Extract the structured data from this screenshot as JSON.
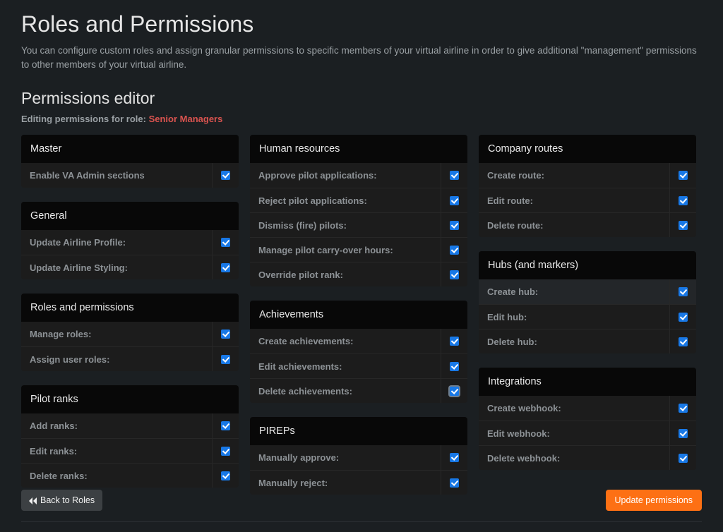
{
  "header": {
    "title": "Roles and Permissions",
    "intro": "You can configure custom roles and assign granular permissions to specific members of your virtual airline in order to give additional \"management\" permissions to other members of your virtual airline.",
    "section_title": "Permissions editor",
    "editing_prefix": "Editing permissions for role:",
    "role_name": "Senior Managers"
  },
  "colors": {
    "page_bg": "#1b1f22",
    "card_bg": "#1c1c1c",
    "card_header_bg": "#080808",
    "accent_orange": "#fd7014",
    "role_red": "#d9534f",
    "checkbox_blue": "#1878e6",
    "label_text": "#8d9296"
  },
  "columns": [
    {
      "cards": [
        {
          "title": "Master",
          "rows": [
            {
              "label": "Enable VA Admin sections",
              "checked": true,
              "hover": false,
              "focused": false
            }
          ]
        },
        {
          "title": "General",
          "rows": [
            {
              "label": "Update Airline Profile:",
              "checked": true,
              "hover": false,
              "focused": false
            },
            {
              "label": "Update Airline Styling:",
              "checked": true,
              "hover": false,
              "focused": false
            }
          ]
        },
        {
          "title": "Roles and permissions",
          "rows": [
            {
              "label": "Manage roles:",
              "checked": true,
              "hover": false,
              "focused": false
            },
            {
              "label": "Assign user roles:",
              "checked": true,
              "hover": false,
              "focused": false
            }
          ]
        },
        {
          "title": "Pilot ranks",
          "rows": [
            {
              "label": "Add ranks:",
              "checked": true,
              "hover": false,
              "focused": false
            },
            {
              "label": "Edit ranks:",
              "checked": true,
              "hover": false,
              "focused": false
            },
            {
              "label": "Delete ranks:",
              "checked": true,
              "hover": false,
              "focused": false
            }
          ]
        }
      ]
    },
    {
      "cards": [
        {
          "title": "Human resources",
          "rows": [
            {
              "label": "Approve pilot applications:",
              "checked": true,
              "hover": false,
              "focused": false
            },
            {
              "label": "Reject pilot applications:",
              "checked": true,
              "hover": false,
              "focused": false
            },
            {
              "label": "Dismiss (fire) pilots:",
              "checked": true,
              "hover": false,
              "focused": false
            },
            {
              "label": "Manage pilot carry-over hours:",
              "checked": true,
              "hover": false,
              "focused": false
            },
            {
              "label": "Override pilot rank:",
              "checked": true,
              "hover": false,
              "focused": false
            }
          ]
        },
        {
          "title": "Achievements",
          "rows": [
            {
              "label": "Create achievements:",
              "checked": true,
              "hover": false,
              "focused": false
            },
            {
              "label": "Edit achievements:",
              "checked": true,
              "hover": false,
              "focused": false
            },
            {
              "label": "Delete achievements:",
              "checked": true,
              "hover": false,
              "focused": true
            }
          ]
        },
        {
          "title": "PIREPs",
          "rows": [
            {
              "label": "Manually approve:",
              "checked": true,
              "hover": false,
              "focused": false
            },
            {
              "label": "Manually reject:",
              "checked": true,
              "hover": false,
              "focused": false
            }
          ]
        }
      ]
    },
    {
      "cards": [
        {
          "title": "Company routes",
          "rows": [
            {
              "label": "Create route:",
              "checked": true,
              "hover": false,
              "focused": false
            },
            {
              "label": "Edit route:",
              "checked": true,
              "hover": false,
              "focused": false
            },
            {
              "label": "Delete route:",
              "checked": true,
              "hover": false,
              "focused": false
            }
          ]
        },
        {
          "title": "Hubs (and markers)",
          "rows": [
            {
              "label": "Create hub:",
              "checked": true,
              "hover": true,
              "focused": false
            },
            {
              "label": "Edit hub:",
              "checked": true,
              "hover": false,
              "focused": false
            },
            {
              "label": "Delete hub:",
              "checked": true,
              "hover": false,
              "focused": false
            }
          ]
        },
        {
          "title": "Integrations",
          "rows": [
            {
              "label": "Create webhook:",
              "checked": true,
              "hover": false,
              "focused": false
            },
            {
              "label": "Edit webhook:",
              "checked": true,
              "hover": false,
              "focused": false
            },
            {
              "label": "Delete webhook:",
              "checked": true,
              "hover": false,
              "focused": false
            }
          ]
        }
      ]
    }
  ],
  "footer": {
    "back_label": "Back to Roles",
    "back_icon": "fast-backward-icon",
    "update_label": "Update permissions"
  }
}
